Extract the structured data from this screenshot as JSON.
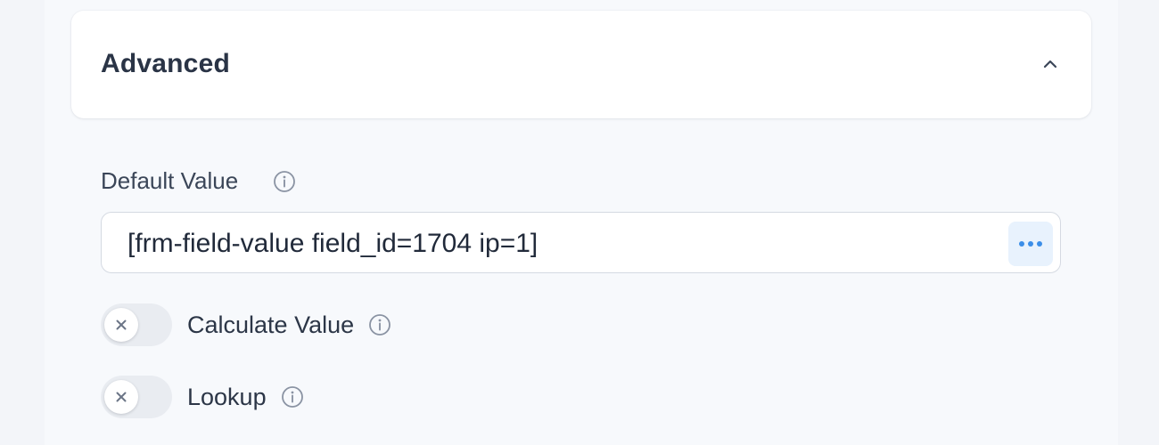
{
  "section": {
    "title": "Advanced",
    "collapse_icon": "chevron-up-icon"
  },
  "default_value": {
    "label": "Default Value",
    "info_icon": "info-icon",
    "value": "[frm-field-value field_id=1704 ip=1]",
    "more_icon": "ellipsis-icon"
  },
  "toggles": [
    {
      "label": "Calculate Value",
      "enabled": false,
      "info_icon": "info-icon"
    },
    {
      "label": "Lookup",
      "enabled": false,
      "info_icon": "info-icon"
    }
  ],
  "colors": {
    "accent": "#3b8ee8",
    "accent_bg": "#e8f2fd",
    "text": "#2a3446",
    "toggle_off": "#e9ecf1"
  }
}
